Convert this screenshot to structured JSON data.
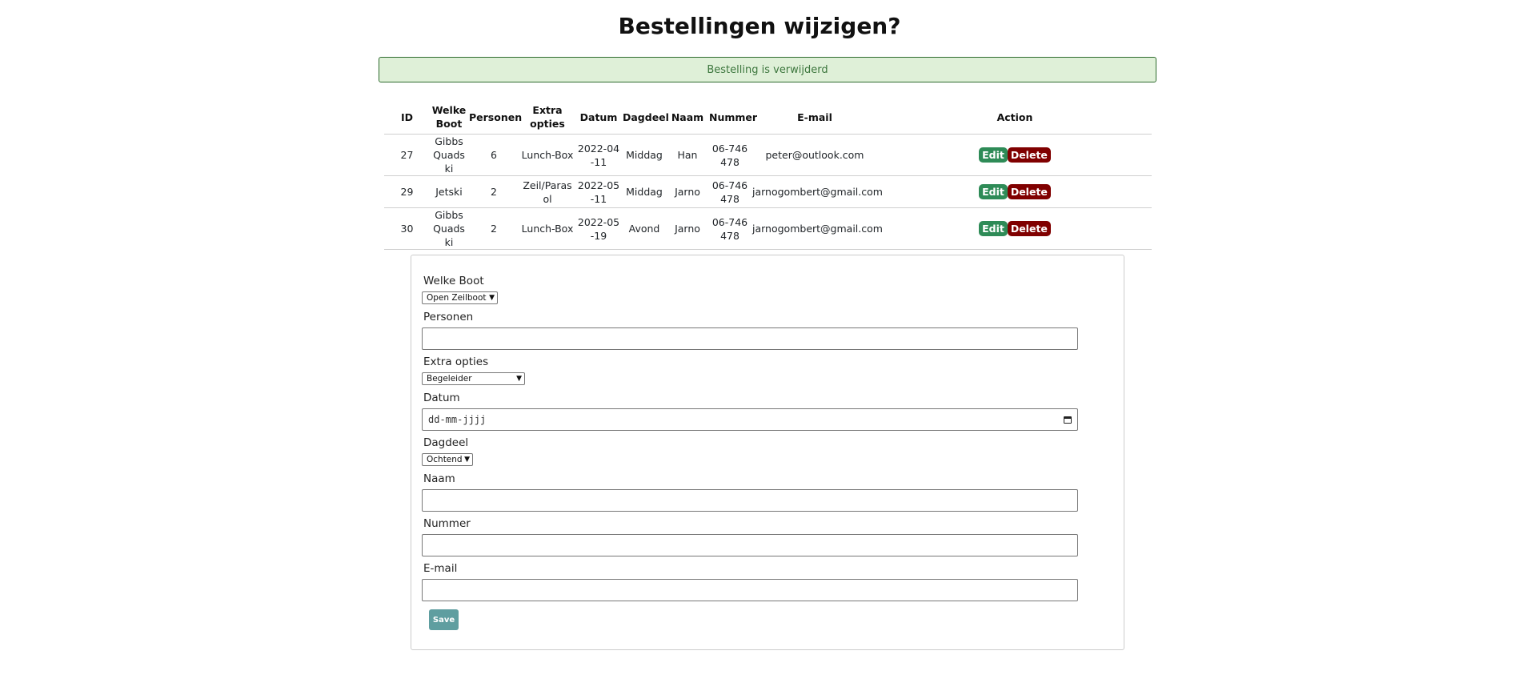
{
  "page": {
    "title": "Bestellingen wijzigen?"
  },
  "alert": {
    "message": "Bestelling is verwijderd"
  },
  "table": {
    "headers": {
      "id": "ID",
      "boot": "Welke Boot",
      "personen": "Personen",
      "extra": "Extra opties",
      "datum": "Datum",
      "dagdeel": "Dagdeel",
      "naam": "Naam",
      "nummer": "Nummer",
      "email": "E-mail",
      "action": "Action"
    },
    "rows": [
      {
        "id": "27",
        "boot": "Gibbs Quadski",
        "personen": "6",
        "extra": "Lunch-Box",
        "datum": "2022-04-11",
        "dagdeel": "Middag",
        "naam": "Han",
        "nummer": "06-746478",
        "email": "peter@outlook.com"
      },
      {
        "id": "29",
        "boot": "Jetski",
        "personen": "2",
        "extra": "Zeil/Parasol",
        "datum": "2022-05-11",
        "dagdeel": "Middag",
        "naam": "Jarno",
        "nummer": "06-746478",
        "email": "jarnogombert@gmail.com"
      },
      {
        "id": "30",
        "boot": "Gibbs Quadski",
        "personen": "2",
        "extra": "Lunch-Box",
        "datum": "2022-05-19",
        "dagdeel": "Avond",
        "naam": "Jarno",
        "nummer": "06-746478",
        "email": "jarnogombert@gmail.com"
      }
    ],
    "edit_label": "Edit",
    "delete_label": "Delete"
  },
  "form": {
    "boot": {
      "label": "Welke Boot",
      "selected": "Open Zeilboot"
    },
    "personen": {
      "label": "Personen",
      "value": ""
    },
    "extra": {
      "label": "Extra opties",
      "selected": "Begeleider"
    },
    "datum": {
      "label": "Datum",
      "placeholder": "dd-mm-jjjj"
    },
    "dagdeel": {
      "label": "Dagdeel",
      "selected": "Ochtend"
    },
    "naam": {
      "label": "Naam",
      "value": ""
    },
    "nummer": {
      "label": "Nummer",
      "value": ""
    },
    "email": {
      "label": "E-mail",
      "value": ""
    },
    "save_label": "Save"
  },
  "colors": {
    "alert_bg": "#dff0d8",
    "edit_button": "#2e8b57",
    "delete_button": "#800000",
    "save_button": "#5f9ea0"
  }
}
